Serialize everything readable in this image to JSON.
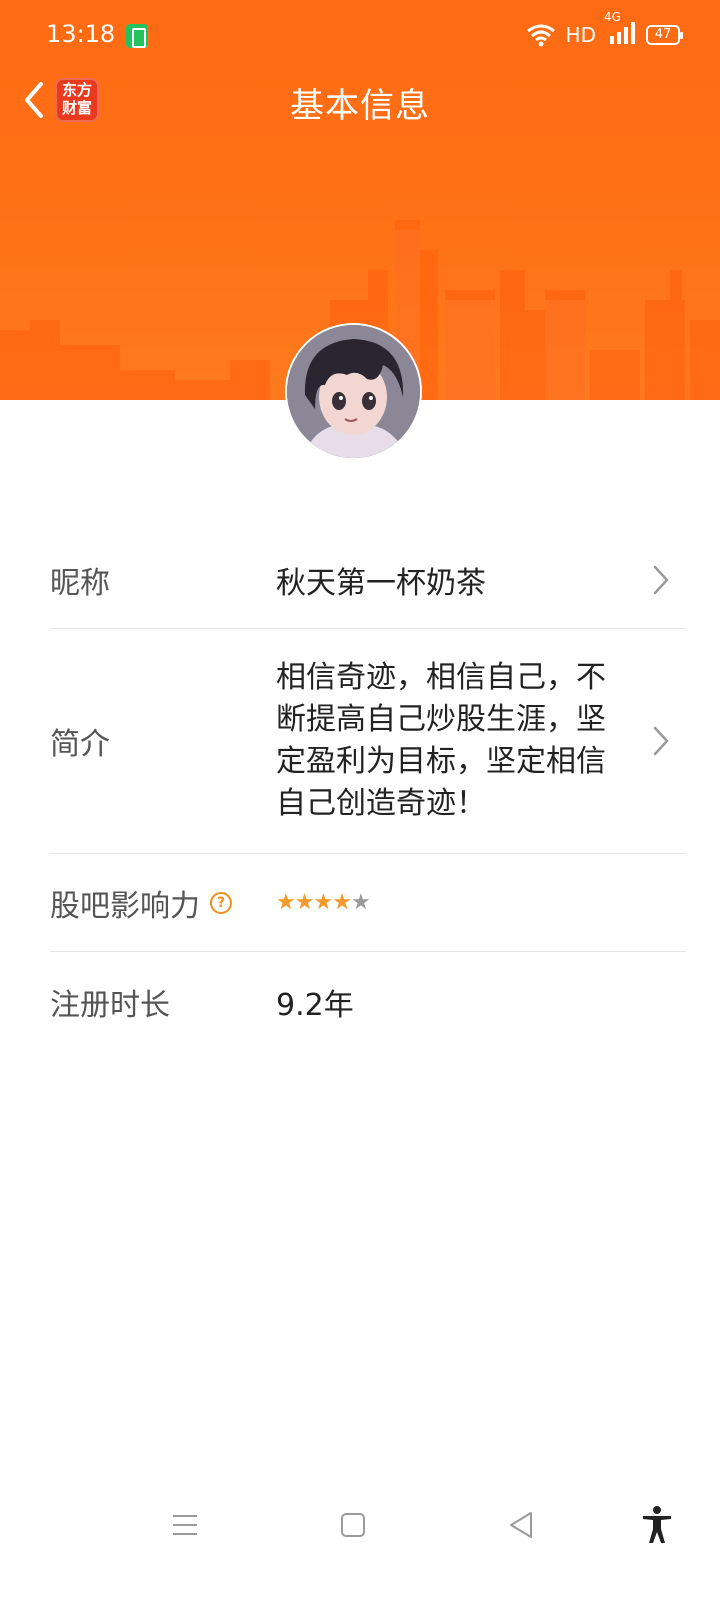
{
  "status_bar": {
    "time": "13:18",
    "network_label": "HD",
    "signal_label": "4G",
    "battery_level": "47"
  },
  "header": {
    "title": "基本信息",
    "logo_text_line1": "东方",
    "logo_text_line2": "财富",
    "background_color": "#ff6d16"
  },
  "profile": {
    "rows": [
      {
        "label": "昵称",
        "value": "秋天第一杯奶茶"
      },
      {
        "label": "简介",
        "value": "相信奇迹，相信自己，不断提高自己炒股生涯，坚定盈利为目标，坚定相信自己创造奇迹！"
      },
      {
        "label": "股吧影响力",
        "rating": 4,
        "rating_max": 5,
        "help": "?"
      },
      {
        "label": "注册时长",
        "value": "9.2年"
      }
    ]
  },
  "icons": {
    "back": "chevron-left-icon",
    "chevron": "chevron-right-icon",
    "help": "question-circle-icon",
    "menu": "menu-icon",
    "home": "square-home-icon",
    "back_nav": "triangle-back-icon",
    "accessibility": "accessibility-icon"
  },
  "colors": {
    "accent": "#ff6d16",
    "star": "#f29a2e",
    "help": "#f0901e"
  }
}
